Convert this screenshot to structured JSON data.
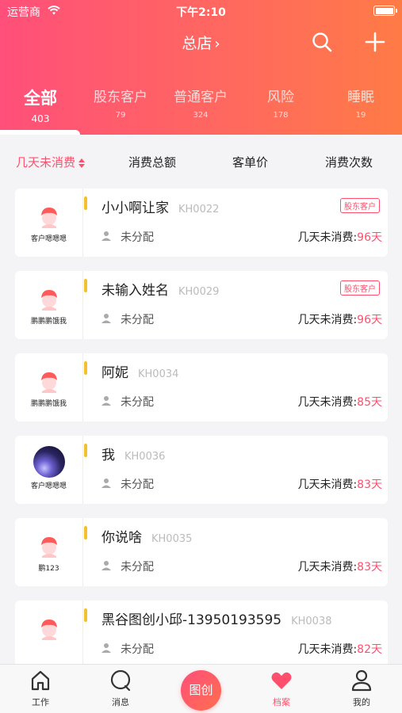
{
  "status_bar": {
    "carrier": "运营商",
    "time": "下午2:10"
  },
  "nav": {
    "title": "总店",
    "chevron": "›"
  },
  "tabs": [
    {
      "label": "全部",
      "count": "403"
    },
    {
      "label": "股东客户",
      "count": "79"
    },
    {
      "label": "普通客户",
      "count": "324"
    },
    {
      "label": "风险",
      "count": "178"
    },
    {
      "label": "睡眠",
      "count": "19"
    }
  ],
  "sort": {
    "days": "几天未消费",
    "total": "消费总额",
    "avg": "客单价",
    "times": "消费次数"
  },
  "customers": [
    {
      "owner": "客户嗯嗯嗯",
      "name": "小小啊让家",
      "code": "KH0022",
      "tag": "股东客户",
      "assign": "未分配",
      "days_label": "几天未消费:",
      "days": "96天"
    },
    {
      "owner": "鹏鹏鹏饿我",
      "name": "未输入姓名",
      "code": "KH0029",
      "tag": "股东客户",
      "assign": "未分配",
      "days_label": "几天未消费:",
      "days": "96天"
    },
    {
      "owner": "鹏鹏鹏饿我",
      "name": "阿妮",
      "code": "KH0034",
      "tag": "",
      "assign": "未分配",
      "days_label": "几天未消费:",
      "days": "85天"
    },
    {
      "owner": "客户嗯嗯嗯",
      "name": "我",
      "code": "KH0036",
      "tag": "",
      "assign": "未分配",
      "days_label": "几天未消费:",
      "days": "83天"
    },
    {
      "owner": "鹏123",
      "name": "你说啥",
      "code": "KH0035",
      "tag": "",
      "assign": "未分配",
      "days_label": "几天未消费:",
      "days": "83天"
    },
    {
      "owner": "",
      "name": "黑谷图创小邱-13950193595",
      "code": "KH0038",
      "tag": "",
      "assign": "未分配",
      "days_label": "几天未消费:",
      "days": "82天"
    }
  ],
  "tabbar": {
    "work": "工作",
    "message": "消息",
    "center": "图创",
    "archive": "档案",
    "mine": "我的"
  },
  "colors": {
    "accent": "#ff4f6d",
    "bar": "#f5c12a",
    "gradient_start": "#ff4f7a",
    "gradient_end": "#ff7b46"
  }
}
